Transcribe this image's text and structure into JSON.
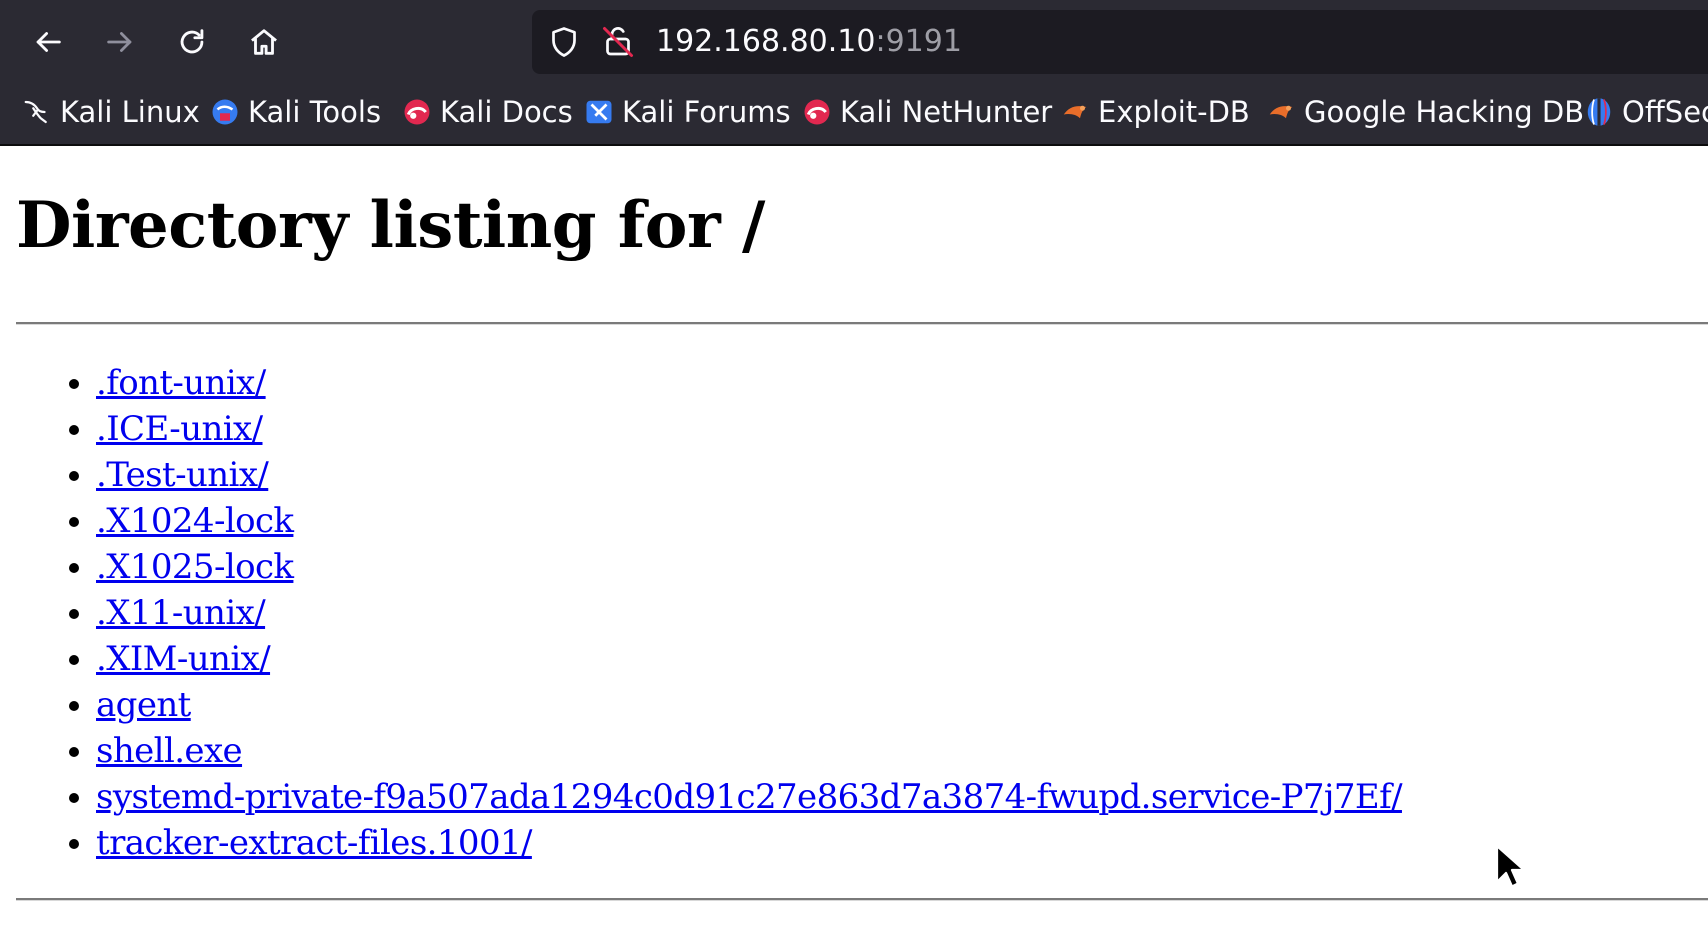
{
  "browser": {
    "url_host": "192.168.80.10",
    "url_port": ":9191",
    "bookmarks": [
      {
        "label": "Kali Linux",
        "icon": "kali-dragon-icon"
      },
      {
        "label": "Kali Tools",
        "icon": "kali-tools-icon"
      },
      {
        "label": "Kali Docs",
        "icon": "kali-docs-icon"
      },
      {
        "label": "Kali Forums",
        "icon": "kali-forums-icon"
      },
      {
        "label": "Kali NetHunter",
        "icon": "kali-nethunter-icon"
      },
      {
        "label": "Exploit-DB",
        "icon": "exploit-db-icon"
      },
      {
        "label": "Google Hacking DB",
        "icon": "ghdb-icon"
      },
      {
        "label": "OffSec",
        "icon": "offsec-icon"
      }
    ]
  },
  "page": {
    "title": "Directory listing for /",
    "entries": [
      ".font-unix/",
      ".ICE-unix/",
      ".Test-unix/",
      ".X1024-lock",
      ".X1025-lock",
      ".X11-unix/",
      ".XIM-unix/",
      "agent",
      "shell.exe",
      "systemd-private-f9a507ada1294c0d91c27e863d7a3874-fwupd.service-P7j7Ef/",
      "tracker-extract-files.1001/"
    ]
  },
  "colors": {
    "chrome_bg": "#2b2a33",
    "urlbar_bg": "#1c1b22",
    "link": "#0000ee"
  }
}
